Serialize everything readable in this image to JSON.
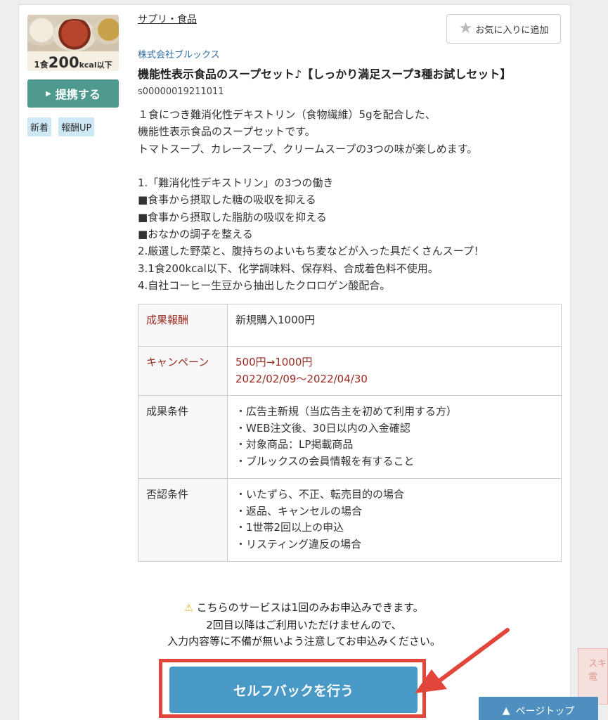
{
  "product": {
    "image_caption": {
      "prefix": "1食",
      "number": "200",
      "suffix": "kcal以下"
    },
    "partner_button": "提携する",
    "badges": [
      "新着",
      "報酬UP"
    ],
    "category": "サプリ・食品",
    "favorite_button": "お気に入りに追加",
    "company": "株式会社ブルックス",
    "title": "機能性表示食品のスープセット♪【しっかり満足スープ3種お試しセット】",
    "code": "s00000019211011",
    "description": "１食につき難消化性デキストリン（食物繊維）5gを配合した、\n機能性表示食品のスープセットです。\nトマトスープ、カレースープ、クリームスープの3つの味が楽しめます。\n\n1.「難消化性デキストリン」の3つの働き\n■食事から摂取した糖の吸収を抑える\n■食事から摂取した脂肪の吸収を抑える\n■おなかの調子を整える\n2.厳選した野菜と、腹持ちのよいもち麦などが入った具だくさんスープ！\n3.1食200kcal以下、化学調味料、保存料、合成着色料不使用。\n4.自社コーヒー生豆から抽出したクロロゲン酸配合。"
  },
  "table": {
    "reward_label": "成果報酬",
    "reward_value": "新規購入1000円",
    "campaign_label": "キャンペーン",
    "campaign_value": "500円→1000円",
    "campaign_period": "2022/02/09〜2022/04/30",
    "conditions_label": "成果条件",
    "conditions": [
      "・広告主新規（当広告主を初めて利用する方）",
      "・WEB注文後、30日以内の入金確認",
      "・対象商品：LP掲載商品",
      "・ブルックスの会員情報を有すること"
    ],
    "rejection_label": "否認条件",
    "rejections": [
      "・いたずら、不正、転売目的の場合",
      "・返品、キャンセルの場合",
      "・1世帯2回以上の申込",
      "・リスティング違反の場合"
    ]
  },
  "notice": {
    "line1": "こちらのサービスは1回のみお申込みできます。",
    "line2": "2回目以降はご利用いただけませんので、",
    "line3": "入力内容等に不備が無いよう注意してお申込みください。"
  },
  "cta_button": "セルフバックを行う",
  "page_top": "ページトップ",
  "corner_text": "スキ電",
  "colors": {
    "teal_button": "#4f9a8e",
    "cta_blue": "#4a9ac7",
    "highlight_red": "#e2463a",
    "label_red": "#9a2b22",
    "company_blue": "#2f6fa6"
  }
}
